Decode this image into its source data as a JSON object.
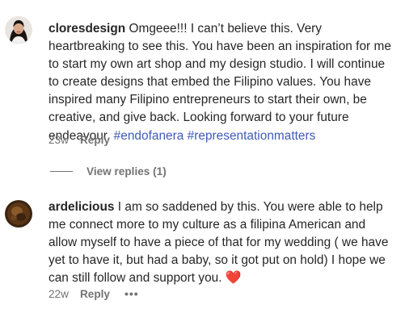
{
  "comments": [
    {
      "username": "cloresdesign",
      "text": "Omgeee!!! I can’t believe this. Very heartbreaking to see this. You have been an inspiration for me to start my own art shop and my design studio. I will continue to create designs that embed the Filipino values. You have inspired many Filipino entrepreneurs to start their own, be creative, and give back. Looking forward to your future endeavour.",
      "hashtags": [
        "#endofanera",
        "#representationmatters"
      ],
      "time": "23w",
      "reply_label": "Reply",
      "view_replies_label": "View replies (1)",
      "avatar_icon": "profile-photo-woman"
    },
    {
      "username": "ardelicious",
      "text": "I am so saddened by this. You were able to help me connect more to my culture as a filipina American and allow myself to have a piece of that for my wedding ( we have yet to have it, but had a baby, so it got put on hold) I hope we can still follow and support you.",
      "emoji": "❤️",
      "time": "22w",
      "reply_label": "Reply",
      "more_label": "•••",
      "avatar_icon": "profile-photo-person"
    }
  ],
  "colors": {
    "text": "#262626",
    "secondary": "#737373",
    "hashtag": "#3f5bb8",
    "heart": "#e0245e"
  }
}
